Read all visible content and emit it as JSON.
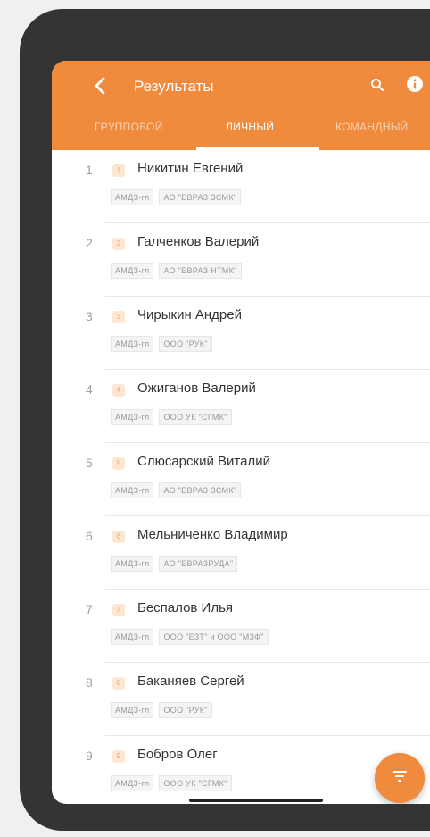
{
  "appbar": {
    "title": "Результаты",
    "back_icon": "back-arrow-icon",
    "search_icon": "search-icon",
    "info_icon": "info-icon"
  },
  "tabs": [
    {
      "label": "ГРУППОВОЙ",
      "active": false
    },
    {
      "label": "ЛИЧНЫЙ",
      "active": true
    },
    {
      "label": "КОМАНДНЫЙ",
      "active": false
    }
  ],
  "results": [
    {
      "rank": "1",
      "place": "1",
      "name": "Никитин Евгений",
      "tags": [
        "АМДЗ-гл",
        "АО \"ЕВРАЗ ЗСМК\""
      ]
    },
    {
      "rank": "2",
      "place": "2",
      "name": "Галченков Валерий",
      "tags": [
        "АМДЗ-гл",
        "АО \"ЕВРАЗ НТМК\""
      ]
    },
    {
      "rank": "3",
      "place": "3",
      "name": "Чирыкин Андрей",
      "tags": [
        "АМДЗ-гл",
        "ООО \"РУК\""
      ]
    },
    {
      "rank": "4",
      "place": "4",
      "name": "Ожиганов Валерий",
      "tags": [
        "АМДЗ-гл",
        "ООО УК \"СГМК\""
      ]
    },
    {
      "rank": "5",
      "place": "5",
      "name": "Слюсарский Виталий",
      "tags": [
        "АМДЗ-гл",
        "АО \"ЕВРАЗ ЗСМК\""
      ]
    },
    {
      "rank": "6",
      "place": "6",
      "name": "Мельниченко Владимир",
      "tags": [
        "АМДЗ-гл",
        "АО \"ЕВРАЗРУДА\""
      ]
    },
    {
      "rank": "7",
      "place": "7",
      "name": "Беспалов Илья",
      "tags": [
        "АМДЗ-гл",
        "ООО \"ЕЗТ\" и ООО \"МЗФ\""
      ]
    },
    {
      "rank": "8",
      "place": "8",
      "name": "Баканяев Сергей",
      "tags": [
        "АМДЗ-гл",
        "ООО \"РУК\""
      ]
    },
    {
      "rank": "9",
      "place": "9",
      "name": "Бобров Олег",
      "tags": [
        "АМДЗ-гл",
        "ООО УК \"СГМК\""
      ]
    }
  ],
  "fab": {
    "icon": "filter-icon"
  },
  "colors": {
    "accent": "#f08a3c",
    "frame": "#343434",
    "background": "#f0f0f0"
  }
}
